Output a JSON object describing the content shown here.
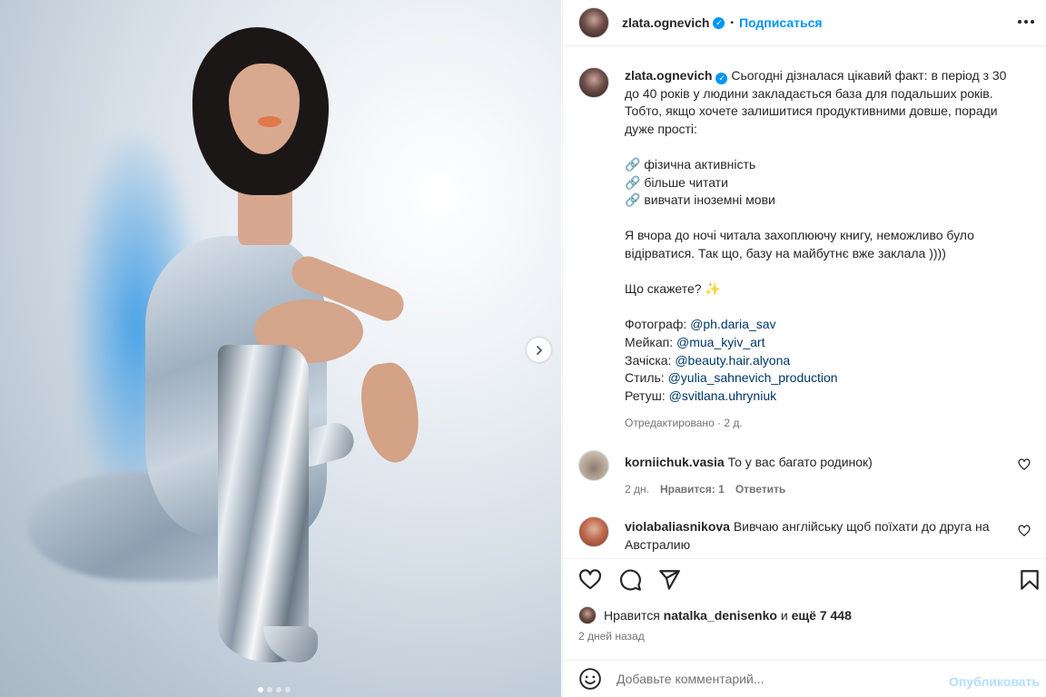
{
  "post": {
    "username": "zlata.ognevich",
    "follow_label": "Подписаться",
    "separator": "•",
    "carousel_count": 4,
    "carousel_active": 0,
    "accent_color": "#0095f6"
  },
  "caption": {
    "lines": [
      "Сьогодні дізналася цікавий факт: в період з 30 до 40 років у людини закладається база для подальших років. Тобто, якщо хочете залишитися продуктивними довше, поради дуже прості:"
    ],
    "tips": [
      {
        "icon": "🔗",
        "text": "фізична активність"
      },
      {
        "icon": "🔗",
        "text": "більше читати"
      },
      {
        "icon": "🔗",
        "text": "вивчати іноземні мови"
      }
    ],
    "story": "Я вчора до ночі читала захоплюючу книгу, неможливо було відірватися. Так що, базу на майбутнє вже заклала ))))",
    "question": "Що скажете? ✨",
    "credits": [
      {
        "role": "Фотограф:",
        "handle": "@ph.daria_sav"
      },
      {
        "role": "Мейкап:",
        "handle": "@mua_kyiv_art"
      },
      {
        "role": "Зачіска:",
        "handle": "@beauty.hair.alyona"
      },
      {
        "role": "Стиль:",
        "handle": "@yulia_sahnevich_production"
      },
      {
        "role": "Ретуш:",
        "handle": "@svitlana.uhryniuk"
      }
    ],
    "meta": "Отредактировано · 2 д."
  },
  "comments": [
    {
      "username": "korniichuk.vasia",
      "text": "То у вас багато родинок)",
      "time": "2 дн.",
      "likes": "Нравится: 1",
      "reply": "Ответить"
    },
    {
      "username": "violabaliasnikova",
      "text": "Вивчаю англійську щоб поїхати до друга на Австралию"
    }
  ],
  "likes": {
    "prefix": "Нравится",
    "user": "natalka_denisenko",
    "middle": "и",
    "rest": "ещё 7 448"
  },
  "time": "2 дней назад",
  "add_comment": {
    "placeholder": "Добавьте комментарий...",
    "publish": "Опубликовать"
  }
}
